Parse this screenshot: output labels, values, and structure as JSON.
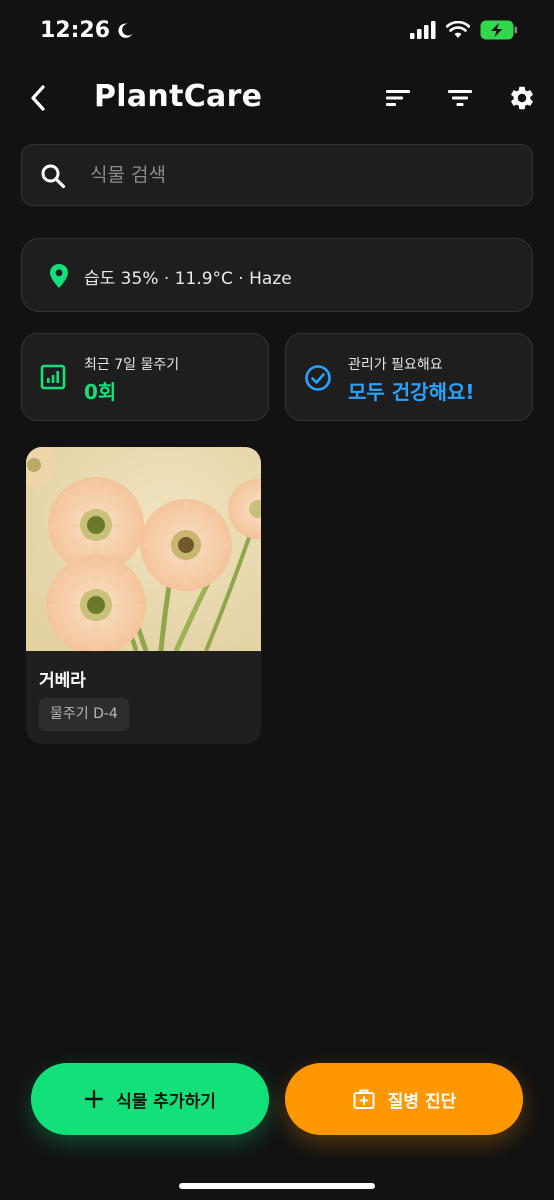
{
  "status_bar": {
    "time": "12:26"
  },
  "header": {
    "title": "PlantCare"
  },
  "search": {
    "placeholder": "식물 검색",
    "value": ""
  },
  "weather": {
    "text": "습도 35% · 11.9°C · Haze"
  },
  "stats": {
    "watering": {
      "label": "최근 7일 물주기",
      "value": "0회",
      "color": "#13e07a"
    },
    "care": {
      "label": "관리가 필요해요",
      "value": "모두 건강해요!",
      "color": "#2aa2ff"
    }
  },
  "plants": [
    {
      "name": "거베라",
      "badge": "물주기 D-4"
    }
  ],
  "actions": {
    "add_label": "식물 추가하기",
    "diagnose_label": "질병 진단"
  },
  "colors": {
    "accent_green": "#13e07a",
    "accent_orange": "#ff9800",
    "accent_blue": "#2aa2ff"
  },
  "icons": [
    "moon-icon",
    "signal-icon",
    "wifi-icon",
    "battery-charging-icon",
    "back-arrow-icon",
    "sort-icon",
    "filter-icon",
    "gear-icon",
    "search-icon",
    "location-pin-icon",
    "chart-icon",
    "check-circle-icon",
    "plus-icon",
    "medical-bag-icon"
  ]
}
